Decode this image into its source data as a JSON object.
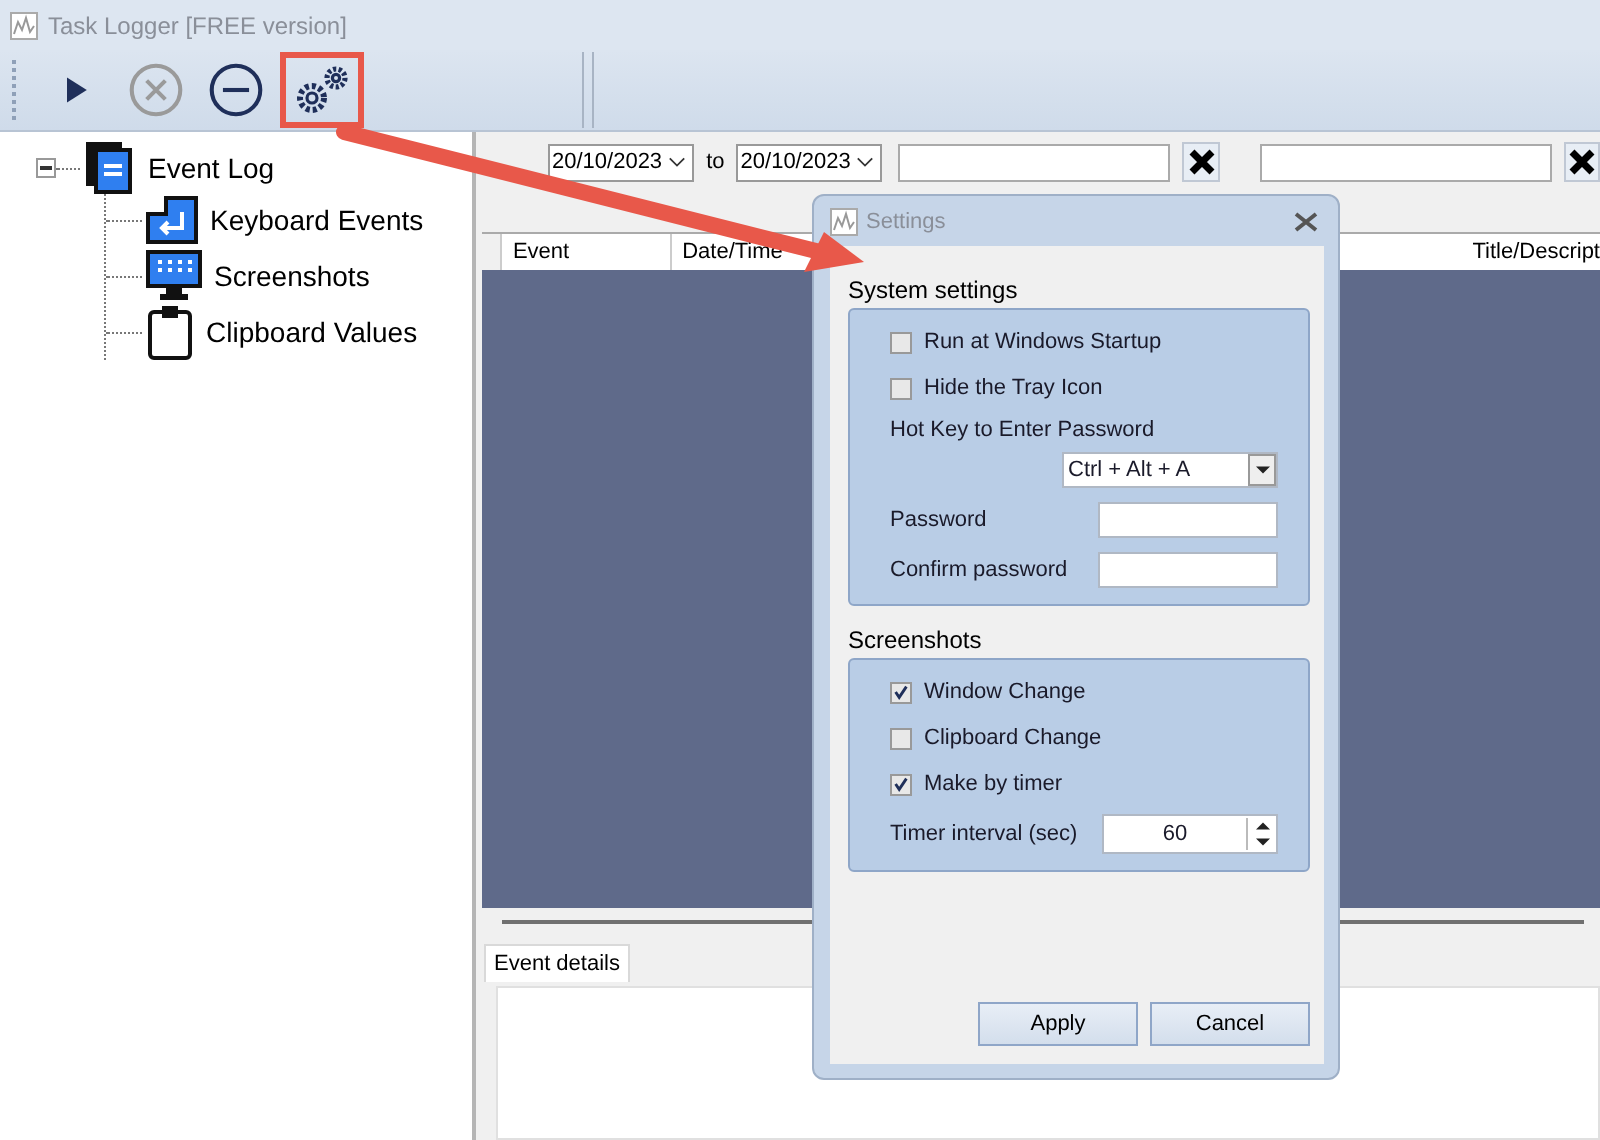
{
  "window": {
    "title": "Task Logger [FREE version]"
  },
  "toolbar": [
    {
      "kind": "play",
      "disabled": false,
      "highlighted": false
    },
    {
      "kind": "cancel",
      "disabled": true,
      "highlighted": false
    },
    {
      "kind": "minus",
      "disabled": false,
      "highlighted": false
    },
    {
      "kind": "settings",
      "disabled": false,
      "highlighted": true
    }
  ],
  "tree": {
    "label": "Event Log",
    "expanded": true,
    "children": [
      {
        "label": "Keyboard Events",
        "kind": "keyboard"
      },
      {
        "label": "Screenshots",
        "kind": "screen"
      },
      {
        "label": "Clipboard Values",
        "kind": "clipboard"
      }
    ]
  },
  "filters": {
    "date_from": "20/10/2023",
    "to_label": "to",
    "date_to": "20/10/2023"
  },
  "table": {
    "columns": [
      "Event",
      "Date/Time",
      "Title/Descript"
    ]
  },
  "details_tab": {
    "label": "Event details",
    "selected": true
  },
  "dialog": {
    "title": "Settings",
    "system": {
      "heading": "System settings",
      "options": [
        {
          "label": "Run at Windows Startup",
          "checked": false
        },
        {
          "label": "Hide the Tray Icon",
          "checked": false
        }
      ],
      "hotkey_label": "Hot Key to Enter Password",
      "hotkey_value": "Ctrl + Alt + A",
      "password_label": "Password",
      "confirm_label": "Confirm password"
    },
    "screenshots": {
      "heading": "Screenshots",
      "options": [
        {
          "label": "Window Change",
          "checked": true
        },
        {
          "label": "Clipboard Change",
          "checked": false
        },
        {
          "label": "Make by timer",
          "checked": true
        }
      ],
      "interval_label": "Timer interval (sec)",
      "interval_value": "60"
    },
    "buttons": [
      "Apply",
      "Cancel"
    ]
  }
}
